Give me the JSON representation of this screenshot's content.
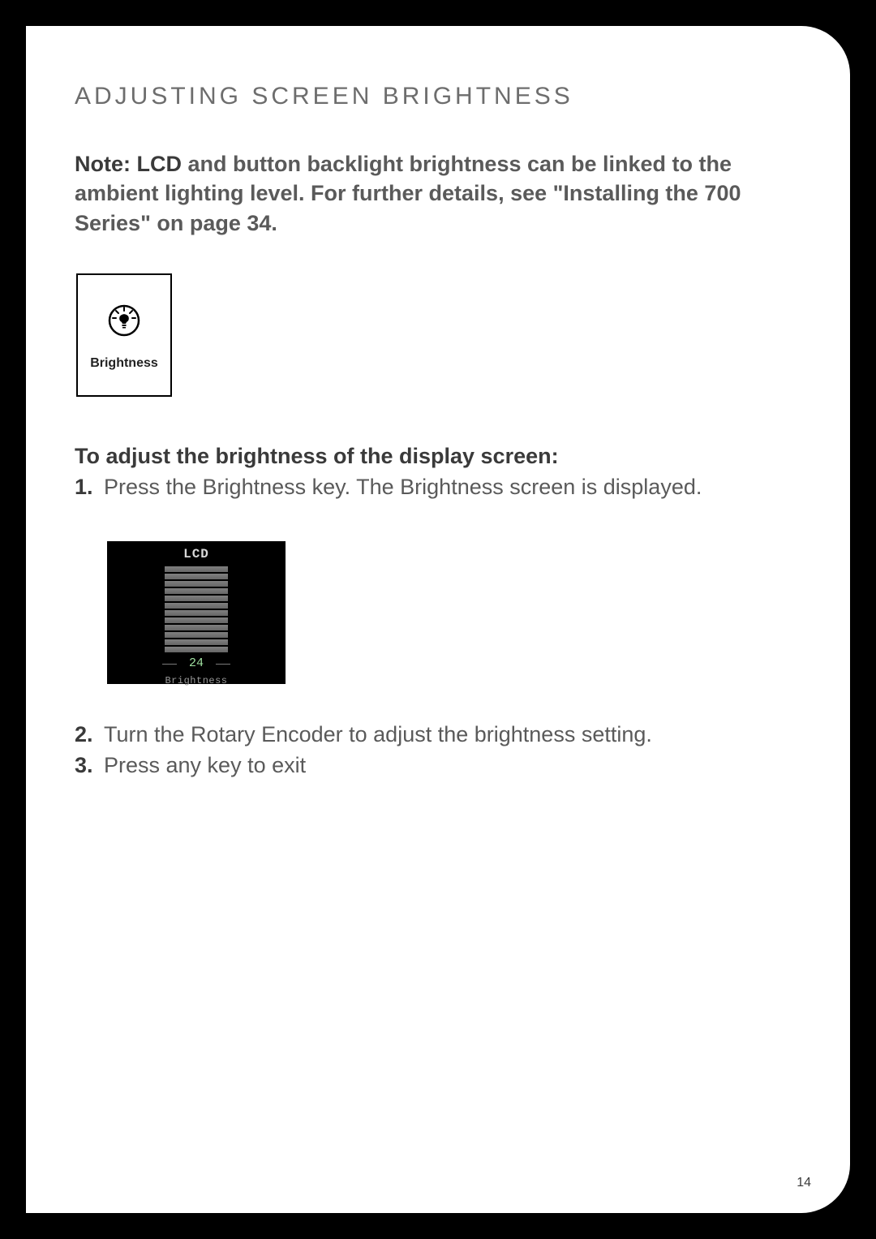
{
  "title": "ADJUSTING SCREEN BRIGHTNESS",
  "note": {
    "lead": "Note: LCD",
    "rest": " and button backlight brightness can be linked to the ambient lighting level. For further details, see \"Installing the 700 Series\" on page 34."
  },
  "key": {
    "icon": "brightness-icon",
    "label": "Brightness"
  },
  "subhead": "To adjust the brightness of the display screen:",
  "steps": [
    "Press the Brightness key. The Brightness screen is displayed.",
    "Turn the Rotary Encoder to adjust the brightness setting.",
    "Press any key to exit"
  ],
  "lcd": {
    "title": "LCD",
    "value": "24",
    "caption": "Brightness",
    "total_bars": 12,
    "lit_bars": 12
  },
  "page_number": "14"
}
